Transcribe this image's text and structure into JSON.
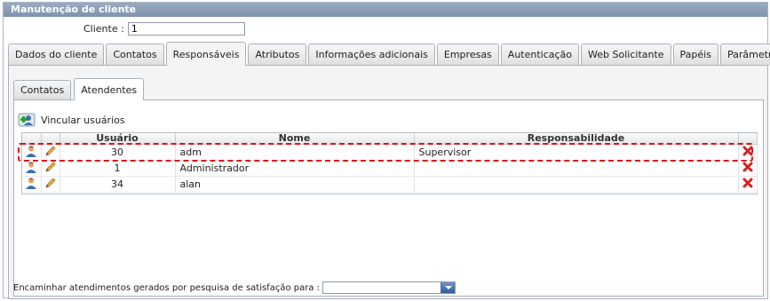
{
  "window": {
    "title": "Manutenção de cliente"
  },
  "cliente": {
    "label": "Cliente :",
    "value": "1"
  },
  "tabs": [
    {
      "label": "Dados do cliente"
    },
    {
      "label": "Contatos"
    },
    {
      "label": "Responsáveis",
      "active": true
    },
    {
      "label": "Atributos"
    },
    {
      "label": "Informações adicionais"
    },
    {
      "label": "Empresas"
    },
    {
      "label": "Autenticação"
    },
    {
      "label": "Web Solicitante"
    },
    {
      "label": "Papéis"
    },
    {
      "label": "Parâmetros"
    }
  ],
  "subtabs": [
    {
      "label": "Contatos"
    },
    {
      "label": "Atendentes",
      "active": true
    }
  ],
  "vincular": {
    "label": "Vincular usuários",
    "icon": "add-user-icon"
  },
  "grid": {
    "headers": {
      "usuario": "Usuário",
      "nome": "Nome",
      "responsabilidade": "Responsabilidade"
    },
    "rows": [
      {
        "usuario": "30",
        "nome": "adm",
        "responsabilidade": "Supervisor"
      },
      {
        "usuario": "1",
        "nome": "Administrador",
        "responsabilidade": ""
      },
      {
        "usuario": "34",
        "nome": "alan",
        "responsabilidade": ""
      }
    ]
  },
  "footer": {
    "label": "Encaminhar atendimentos gerados por pesquisa de satisfação para :",
    "value": ""
  },
  "colors": {
    "title_bar": "#8b9db5",
    "highlight": "#e0101a",
    "delete": "#d62020"
  }
}
